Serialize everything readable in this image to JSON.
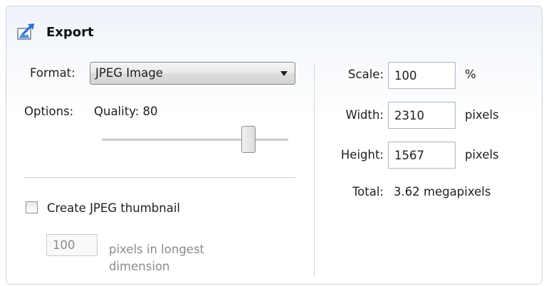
{
  "panel": {
    "title": "Export",
    "icon": "export-image-icon"
  },
  "format": {
    "label": "Format:",
    "selected": "JPEG Image"
  },
  "options": {
    "label": "Options:",
    "quality_label": "Quality: 80",
    "quality_value": 80,
    "quality_max": 100
  },
  "thumbnail": {
    "checkbox_label": "Create JPEG thumbnail",
    "checked": false,
    "size_value": "100",
    "size_caption_line1": "pixels in longest",
    "size_caption_line2": "dimension"
  },
  "scale": {
    "label": "Scale:",
    "value": "100",
    "unit": "%"
  },
  "width": {
    "label": "Width:",
    "value": "2310",
    "unit": "pixels"
  },
  "height": {
    "label": "Height:",
    "value": "1567",
    "unit": "pixels"
  },
  "total": {
    "label": "Total:",
    "value": "3.62 megapixels"
  }
}
